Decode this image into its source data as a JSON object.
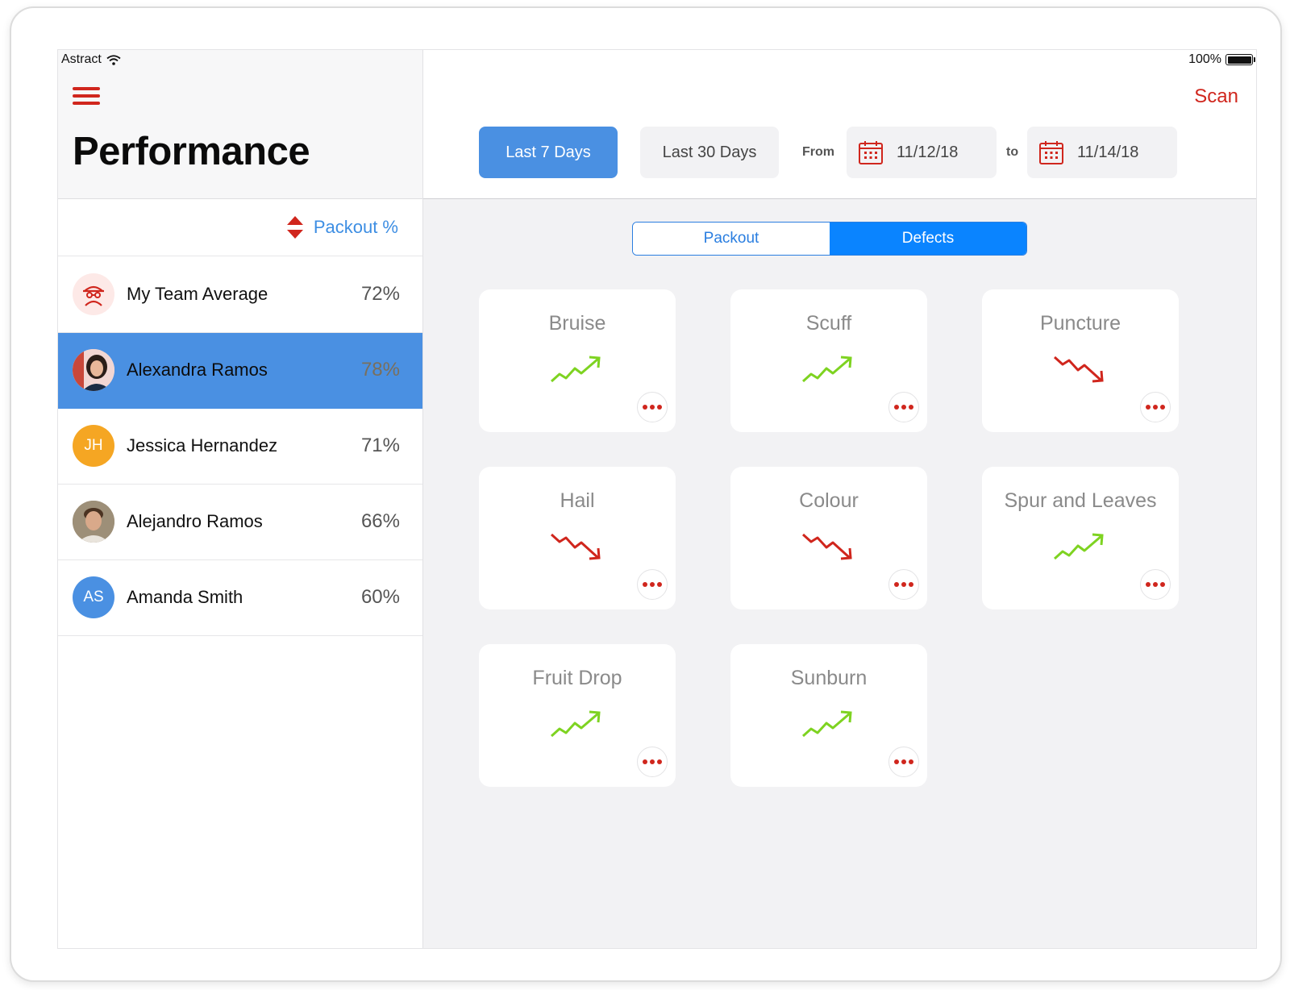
{
  "status_bar": {
    "carrier": "Astract",
    "battery": "100%"
  },
  "sidebar": {
    "title": "Performance",
    "sort_label": "Packout %",
    "people": [
      {
        "name": "My Team Average",
        "pct": "72%",
        "avatar_type": "team-icon",
        "selected": false
      },
      {
        "name": "Alexandra Ramos",
        "pct": "78%",
        "avatar_type": "photo",
        "selected": true
      },
      {
        "name": "Jessica Hernandez",
        "pct": "71%",
        "avatar_type": "initials",
        "initials": "JH",
        "avatar_color": "#f5a623",
        "selected": false
      },
      {
        "name": "Alejandro Ramos",
        "pct": "66%",
        "avatar_type": "photo",
        "selected": false
      },
      {
        "name": "Amanda Smith",
        "pct": "60%",
        "avatar_type": "initials",
        "initials": "AS",
        "avatar_color": "#4a90e2",
        "selected": false
      }
    ]
  },
  "header": {
    "scan_label": "Scan",
    "range_7": "Last 7 Days",
    "range_30": "Last 30 Days",
    "from_label": "From",
    "from_date": "11/12/18",
    "to_label": "to",
    "to_date": "11/14/18"
  },
  "toggle": {
    "packout": "Packout",
    "defects": "Defects",
    "active": "defects"
  },
  "defects": [
    {
      "label": "Bruise",
      "trend": "up"
    },
    {
      "label": "Scuff",
      "trend": "up"
    },
    {
      "label": "Puncture",
      "trend": "down"
    },
    {
      "label": "Hail",
      "trend": "down"
    },
    {
      "label": "Colour",
      "trend": "down"
    },
    {
      "label": "Spur and Leaves",
      "trend": "up"
    },
    {
      "label": "Fruit Drop",
      "trend": "up"
    },
    {
      "label": "Sunburn",
      "trend": "up"
    }
  ],
  "colors": {
    "accent_blue": "#4a90e2",
    "segment_blue": "#0a84ff",
    "brand_red": "#d0261d",
    "trend_up": "#7ed321",
    "trend_down": "#d0261d"
  }
}
